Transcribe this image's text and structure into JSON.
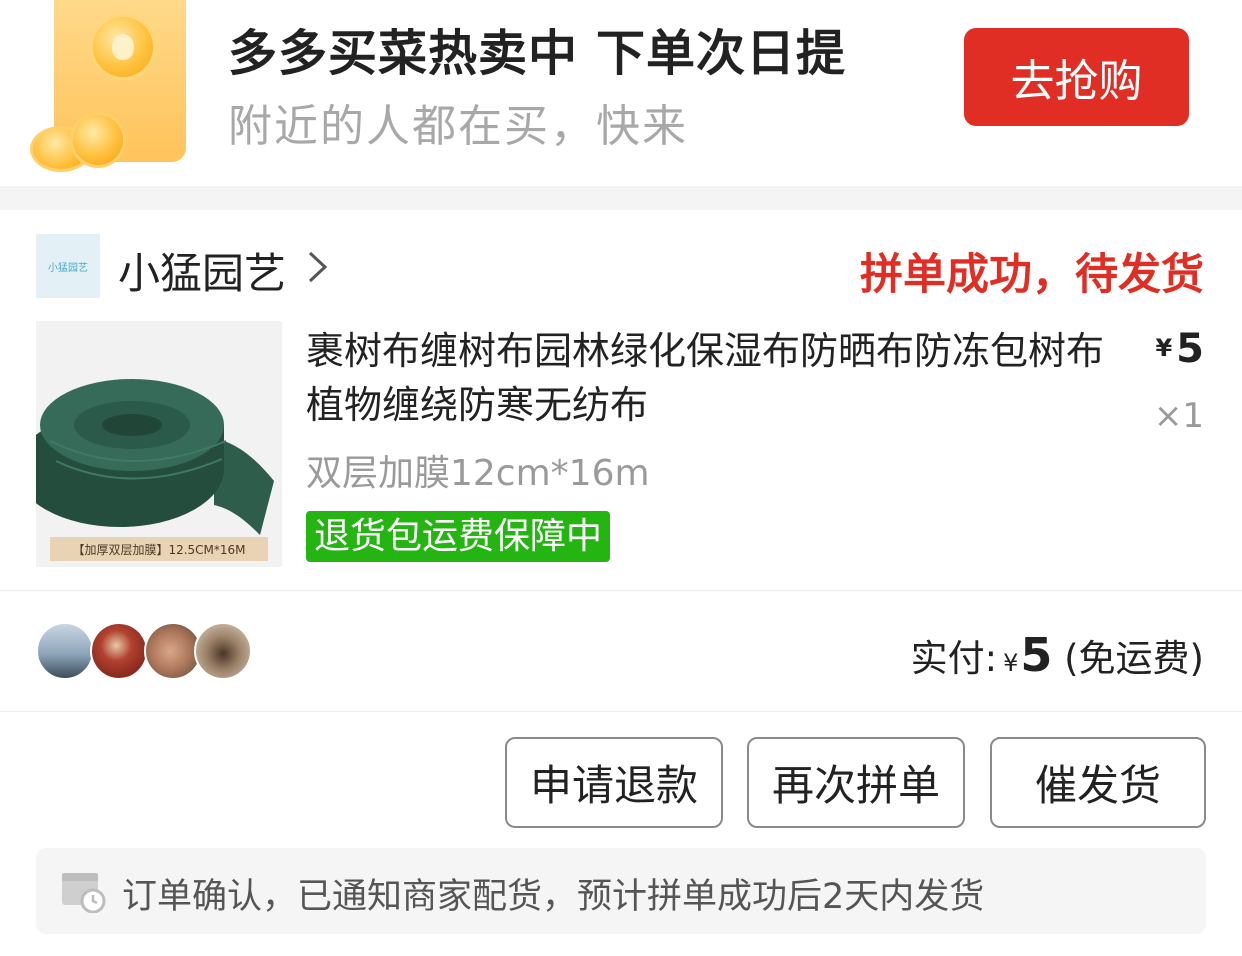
{
  "banner": {
    "title": "多多买菜热卖中 下单次日提",
    "subtitle": "附近的人都在买，快来",
    "button_label": "去抢购",
    "accent_color": "#e02e24"
  },
  "store": {
    "logo_text": "小猛园艺",
    "name": "小猛园艺",
    "arrow_icon": "chevron-right-icon",
    "status": "拼单成功，待发货"
  },
  "product": {
    "image_label": "【加厚双层加膜】12.5CM*16M",
    "title": "裹树布缠树布园林绿化保湿布防晒布防冻包树布植物缠绕防寒无纺布",
    "currency": "¥",
    "price": "5",
    "quantity": "×1",
    "spec": "双层加膜12cm*16m",
    "guarantee_badge": "退货包运费保障中",
    "guarantee_color": "#25b513"
  },
  "payment": {
    "label": "实付:",
    "currency": "¥",
    "amount": "5",
    "note": "(免运费)"
  },
  "actions": {
    "refund_label": "申请退款",
    "reorder_label": "再次拼单",
    "urge_label": "催发货"
  },
  "notice": {
    "icon": "calendar-clock-icon",
    "text": "订单确认，已通知商家配货，预计拼单成功后2天内发货"
  }
}
